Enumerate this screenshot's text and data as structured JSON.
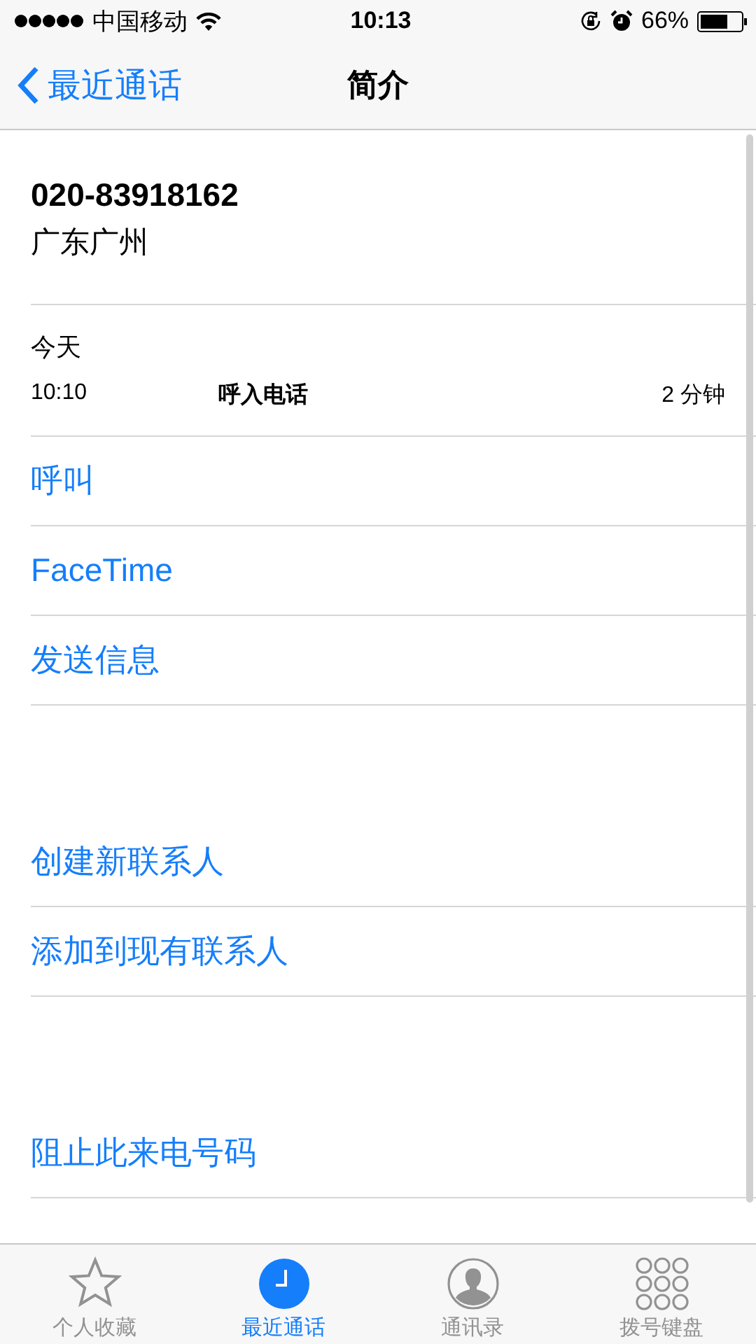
{
  "status_bar": {
    "carrier": "中国移动",
    "time": "10:13",
    "battery": "66%"
  },
  "nav": {
    "back": "最近通话",
    "title": "简介"
  },
  "contact": {
    "number": "020-83918162",
    "location": "广东广州"
  },
  "history": {
    "day": "今天",
    "calls": [
      {
        "time": "10:10",
        "type": "呼入电话",
        "duration": "2 分钟"
      }
    ]
  },
  "action_groups": [
    {
      "items": [
        "呼叫",
        "FaceTime",
        "发送信息"
      ]
    },
    {
      "items": [
        "创建新联系人",
        "添加到现有联系人"
      ]
    },
    {
      "items": [
        "阻止此来电号码"
      ]
    }
  ],
  "tabs": [
    {
      "label": "个人收藏",
      "kind": "star",
      "selected": false
    },
    {
      "label": "最近通话",
      "kind": "clock",
      "selected": true
    },
    {
      "label": "通讯录",
      "kind": "person",
      "selected": false
    },
    {
      "label": "拨号键盘",
      "kind": "keypad",
      "selected": false
    }
  ]
}
